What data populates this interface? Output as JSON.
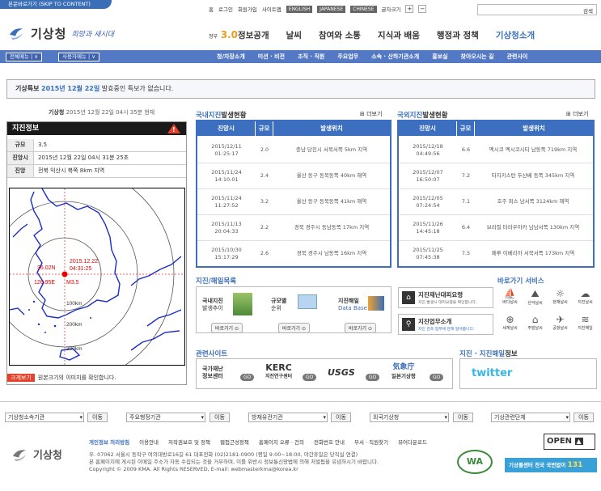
{
  "top": {
    "skip": "본문바로가기 (SKIP TO CONTENT)",
    "util": [
      "홈",
      "로그인",
      "회원가입",
      "사이트맵"
    ],
    "langs": [
      "ENGLISH",
      "JAPANESE",
      "CHINESE"
    ],
    "fontsize": "글자크기",
    "search_btn": "검색"
  },
  "logo": {
    "name": "기상청",
    "slogan": "희망과 새시대"
  },
  "gnb": {
    "brand_pre": "정부",
    "brand": "정보공개",
    "items": [
      "날씨",
      "참여와 소통",
      "지식과 배움",
      "행정과 정책",
      "기상청소개"
    ]
  },
  "bar": {
    "btn1": "전체메뉴",
    "btn2": "사용자메뉴",
    "subnav": [
      "청/차장소개",
      "미션 · 비전",
      "조직 · 직원",
      "주요업무",
      "소속 · 산하기관소개",
      "홍보실",
      "찾아오시는 길",
      "관련사이"
    ]
  },
  "notice": {
    "label": "기상특보",
    "date": "2015년 12월 22일",
    "text": "발효중인 특보가 없습니다."
  },
  "left": {
    "head": "기상청",
    "head_time": "2015년 12월 22일 04시 35분 현재",
    "title": "지진정보",
    "rows": [
      {
        "k": "규모",
        "v": "3.5"
      },
      {
        "k": "진앙시",
        "v": "2015년 12월 22일 04시 31분 25초"
      },
      {
        "k": "진앙",
        "v": "전북 익산시 북쪽 8km 지역"
      }
    ],
    "map": {
      "date": "2015.12.22.",
      "time": "04:31:25",
      "lat": "36.02N",
      "lon": "126.95E",
      "mag": "M3.5",
      "r1": "100km",
      "r2": "200km",
      "r3": "300km"
    },
    "cap_btn": "크게보기",
    "cap": "원본크기의 이미지를 확인합니다."
  },
  "domestic": {
    "title_a": "국내지진",
    "title_b": "발생현황",
    "more": "더보기",
    "cols": [
      "진앙시",
      "규모",
      "발생위치"
    ],
    "rows": [
      {
        "t1": "2015/12/11",
        "t2": "01:25:17",
        "m": "2.0",
        "loc": "충남 당진시 서북서쪽 5km 지역"
      },
      {
        "t1": "2015/11/24",
        "t2": "14:10:01",
        "m": "2.4",
        "loc": "울산 동구 동북동쪽 40km 해역"
      },
      {
        "t1": "2015/11/24",
        "t2": "11:27:52",
        "m": "3.2",
        "loc": "울산 동구 동북동쪽 41km 해역"
      },
      {
        "t1": "2015/11/13",
        "t2": "20:04:33",
        "m": "2.2",
        "loc": "경북 경주시 동남동쪽 17km 지역"
      },
      {
        "t1": "2015/10/30",
        "t2": "15:17:29",
        "m": "2.6",
        "loc": "경북 경주시 남동쪽 16km 지역"
      }
    ]
  },
  "foreign": {
    "title_a": "국외지진",
    "title_b": "발생현황",
    "more": "더보기",
    "cols": [
      "진앙시",
      "규모",
      "발생위치"
    ],
    "rows": [
      {
        "t1": "2015/12/18",
        "t2": "04:49:56",
        "m": "6.6",
        "loc": "멕시코 멕시코시티 남동쪽 719km 지역"
      },
      {
        "t1": "2015/12/07",
        "t2": "16:50:07",
        "m": "7.2",
        "loc": "타지키스탄 두샨베 동쪽 345km 지역"
      },
      {
        "t1": "2015/12/05",
        "t2": "07:24:54",
        "m": "7.1",
        "loc": "호주 퍼스 남서쪽 3124km 해역"
      },
      {
        "t1": "2015/11/26",
        "t2": "14:45:18",
        "m": "6.4",
        "loc": "브라질 타라우아카 남남서쪽 130km 지역"
      },
      {
        "t1": "2015/11/25",
        "t2": "07:45:38",
        "m": "7.5",
        "loc": "페루 이베리아 서북서쪽 173km 지역"
      }
    ]
  },
  "tsunami": {
    "title": "지진/해일목록",
    "items": [
      {
        "l1": "국내지진",
        "l2": "발생추이"
      },
      {
        "l1": "규모별",
        "l2": "순위"
      },
      {
        "l1": "지진해일",
        "l2": "Data Base"
      }
    ],
    "go": "바로가기"
  },
  "guide": {
    "i1": "지진재난대피요령",
    "i1s": "지진 발생시 대피요령을 확인합니다.",
    "i2": "지진업무소개",
    "i2s": "지진 관측 업무에 관해 알아봅니다."
  },
  "quick": {
    "title": "바로가기 서비스",
    "items": [
      "바다날씨",
      "산악날씨",
      "현재날씨",
      "지진날씨",
      "세계날씨",
      "주말날씨",
      "공항날씨",
      "지진해일"
    ]
  },
  "related": {
    "title": "관련사이트",
    "items": [
      {
        "a": "국가재난",
        "b": "정보센터"
      },
      {
        "a": "KERC",
        "b": "지진연구센터"
      },
      {
        "a": "USGS",
        "b": ""
      },
      {
        "a": "気象庁",
        "b": "일본기상청"
      }
    ],
    "go": "GO"
  },
  "social": {
    "title_a": "지진 · 지진해일",
    "title_b": "정보",
    "twitter": "twitter"
  },
  "footer": {
    "selects": [
      "기상청소속기관",
      "주요행정기관",
      "방재유관기관",
      "외국기상청",
      "기상관련단체"
    ],
    "go": "이동",
    "links": [
      "개인정보 처리방침",
      "이용안내",
      "저작권보호 및 정책",
      "웹접근성정책",
      "홈페이지 오류 · 건의",
      "전화번호 안내",
      "부서 · 직원찾기",
      "뷰어다운로드"
    ],
    "addr1": "우. 07062 서울시 동작구 여의대방로16길 61 대표전화 (02)2181-0900 (평일 9:00~18:00, 야간휴일은 당직실 연결)",
    "addr2": "본 홈페이지에 게시된 이메일 주소가 자동 수집되는 것을 거부하며, 이를 위반시 정보통신망법에 의해 처벌됨을 유념하시기 바랍니다.",
    "addr3": "Copyright © 2009 KMA. All Rights RESERVED, E-mail: webmasterkma@korea.kr",
    "open": "OPEN",
    "call": "기상콜센터 전국 국번없이",
    "call_num": "131",
    "wa": "WA"
  },
  "colors": {
    "blue": "#3d6fc0",
    "bar": "#5378c4",
    "red": "#e8412b"
  }
}
